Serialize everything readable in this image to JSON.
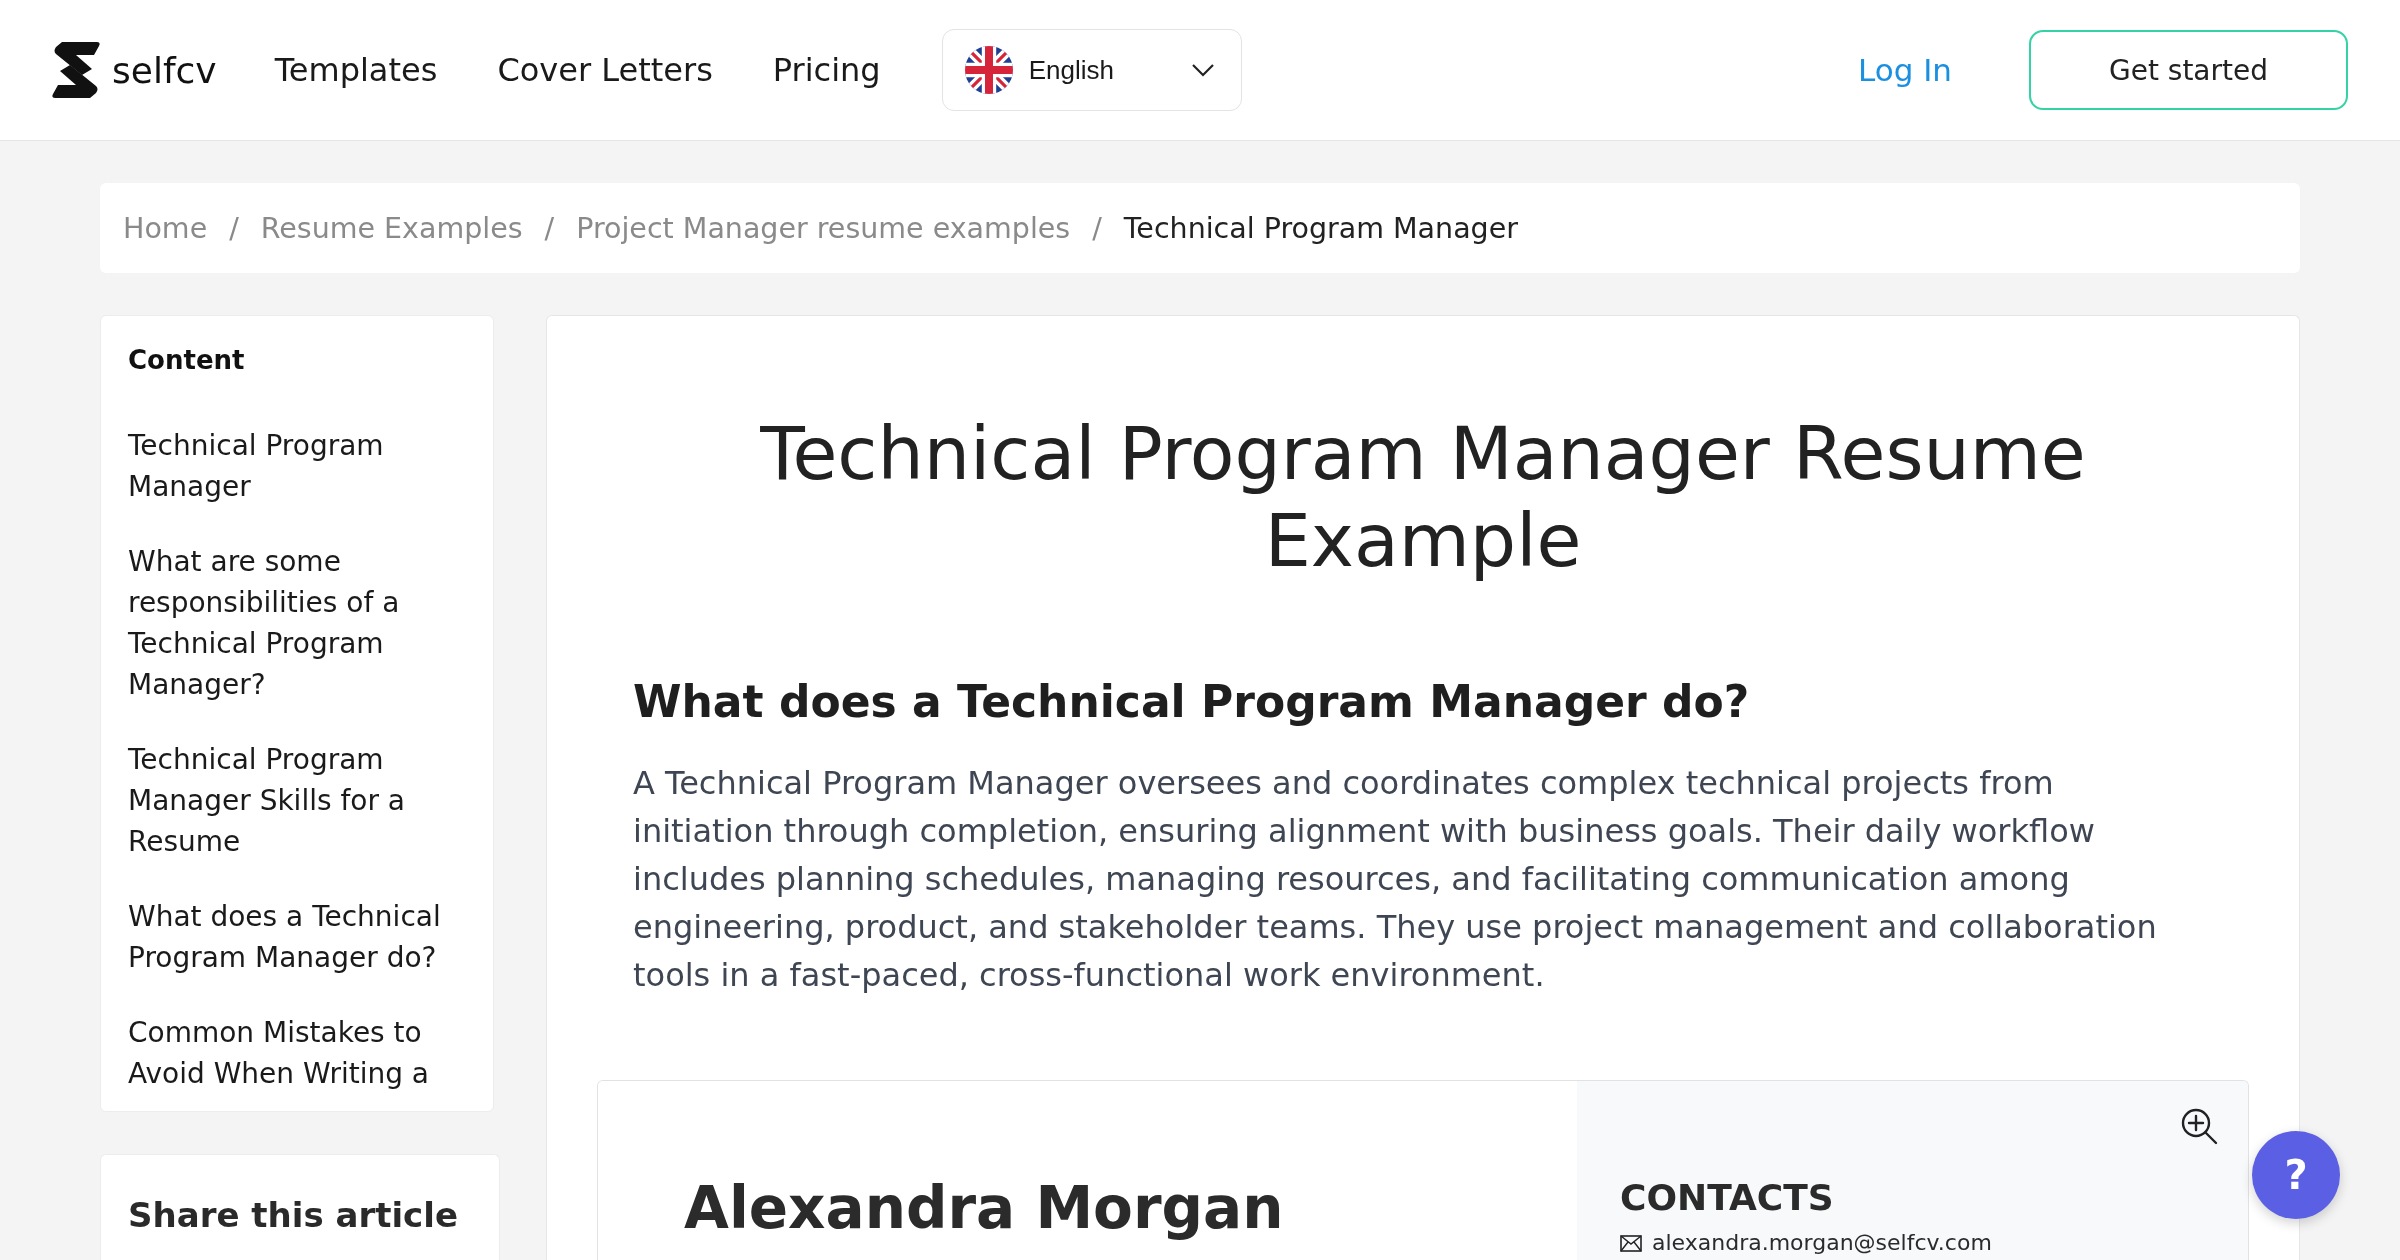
{
  "header": {
    "brand": "selfcv",
    "nav": [
      "Templates",
      "Cover Letters",
      "Pricing"
    ],
    "language": {
      "value": "English"
    },
    "login": "Log In",
    "cta": "Get started"
  },
  "breadcrumb": [
    {
      "label": "Home",
      "current": false,
      "separator": "/"
    },
    {
      "label": "Resume Examples",
      "current": false,
      "separator": "/"
    },
    {
      "label": "Project Manager resume examples",
      "current": false,
      "separator": "/"
    },
    {
      "label": "Technical Program Manager",
      "current": true
    }
  ],
  "sidebar": {
    "title": "Content",
    "items": [
      "Technical Program Manager",
      "What are some responsibilities of a Technical Program Manager?",
      "Technical Program Manager Skills for a Resume",
      "What does a Technical Program Manager do?",
      "Common Mistakes to Avoid When Writing a"
    ]
  },
  "share": {
    "title": "Share this article"
  },
  "article": {
    "title": "Technical Program Manager Resume Example",
    "heading": "What does a Technical Program Manager do?",
    "paragraph": "A Technical Program Manager oversees and coordinates complex technical projects from initiation through completion, ensuring alignment with business goals. Their daily workflow includes planning schedules, managing resources, and facilitating communication among engineering, product, and stakeholder teams. They use project management and collaboration tools in a fast-paced, cross-functional work environment."
  },
  "resume_preview": {
    "name": "Alexandra Morgan",
    "contacts_title": "CONTACTS",
    "email": "alexandra.morgan@selfcv.com"
  },
  "help_button": {
    "label": "?"
  }
}
